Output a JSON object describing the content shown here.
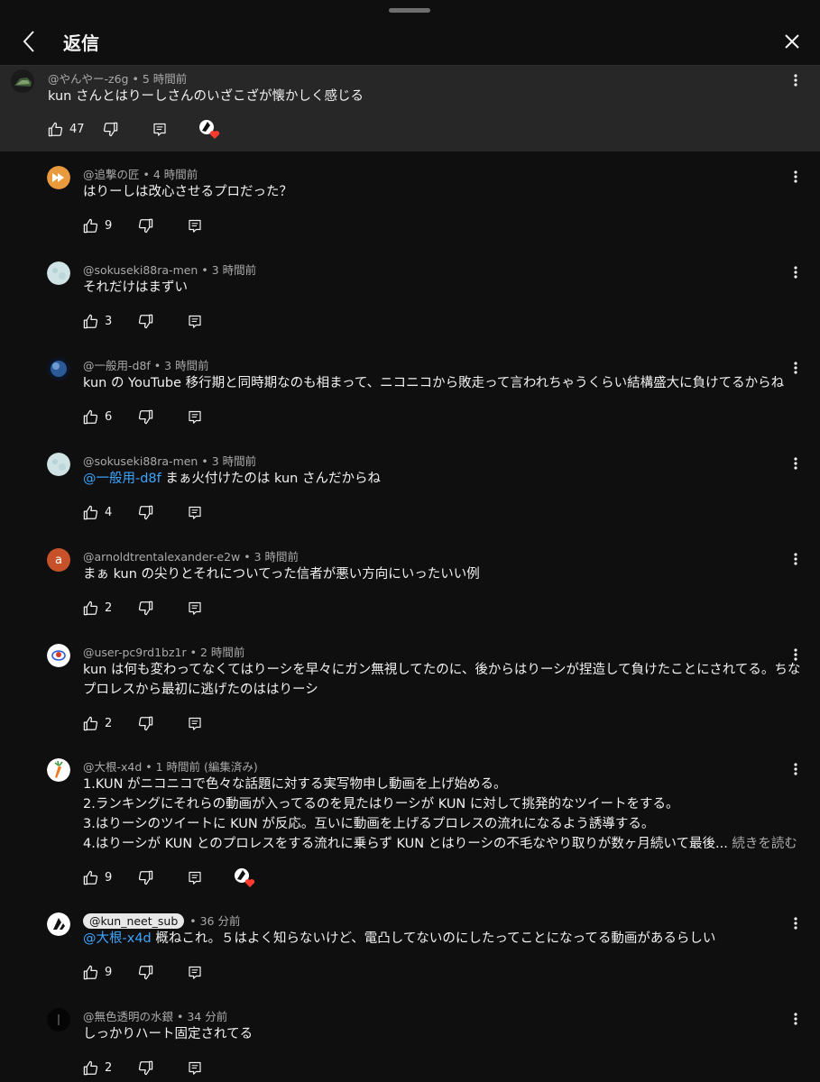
{
  "header": {
    "title": "返信"
  },
  "parent": {
    "handle": "@やんやー-z6g",
    "time": "5 時間前",
    "text": "kun さんとはりーしさんのいざこざが懐かしく感じる",
    "likes": "47"
  },
  "replies": [
    {
      "handle": "@追撃の匠",
      "time": "4 時間前",
      "lines": [
        "はりーしは改心させるプロだった？"
      ],
      "likes": "9"
    },
    {
      "handle": "@sokuseki88ra-men",
      "time": "3 時間前",
      "lines": [
        "それだけはまずい"
      ],
      "likes": "3"
    },
    {
      "handle": "@一般用-d8f",
      "time": "3 時間前",
      "lines": [
        "kun の YouTube 移行期と同時期なのも相まって、ニコニコから敗走って言われちゃうくらい結構盛大に負けてるからね"
      ],
      "likes": "6"
    },
    {
      "handle": "@sokuseki88ra-men",
      "time": "3 時間前",
      "mention": "@一般用-d8f",
      "lines": [
        " まぁ火付けたのは kun さんだからね"
      ],
      "likes": "4"
    },
    {
      "handle": "@arnoldtrentalexander-e2w",
      "time": "3 時間前",
      "avatar_letter": "a",
      "lines": [
        "まぁ kun の尖りとそれについてった信者が悪い方向にいったいい例"
      ],
      "likes": "2"
    },
    {
      "handle": "@user-pc9rd1bz1r",
      "time": "2 時間前",
      "lines": [
        "kun は何も変わってなくてはりーシを早々にガン無視してたのに、後からはりーシが捏造して負けたことにされてる。ちな",
        "プロレスから最初に逃げたのははりーシ"
      ],
      "likes": "2"
    },
    {
      "handle": "@大根-x4d",
      "time": "1 時間前 (編集済み)",
      "lines": [
        "1.KUN がニコニコで色々な話題に対する実写物申し動画を上げ始める。",
        "2.ランキングにそれらの動画が入ってるのを見たはりーシが KUN に対して挑発的なツイートをする。",
        "3.はりーシのツイートに KUN が反応。互いに動画を上げるプロレスの流れになるよう誘導する。",
        "4.はりーシが KUN とのプロレスをする流れに乗らず KUN とはりーシの不毛なやり取りが数ヶ月続いて最後..."
      ],
      "read_more": "続きを読む",
      "likes": "9"
    },
    {
      "handle": "@kun_neet_sub",
      "time": "36 分前",
      "mention": "@大根-x4d",
      "lines": [
        " 概ねこれ。５はよく知らないけど、電凸してないのにしたってことになってる動画があるらしい"
      ],
      "likes": "9"
    },
    {
      "handle": "@無色透明の水銀",
      "time": "34 分前",
      "lines": [
        "しっかりハート固定されてる"
      ],
      "likes": "2"
    }
  ],
  "colors": {
    "background": "#0f0f0f",
    "parent_bg": "#272727",
    "mention": "#3ea6ff",
    "meta": "#aaaaaa",
    "heart": "#ff3b30"
  },
  "icons": [
    "chevron-left-icon",
    "close-icon",
    "thumb-up-icon",
    "thumb-down-icon",
    "reply-icon",
    "creator-heart-icon",
    "more-vert-icon"
  ]
}
